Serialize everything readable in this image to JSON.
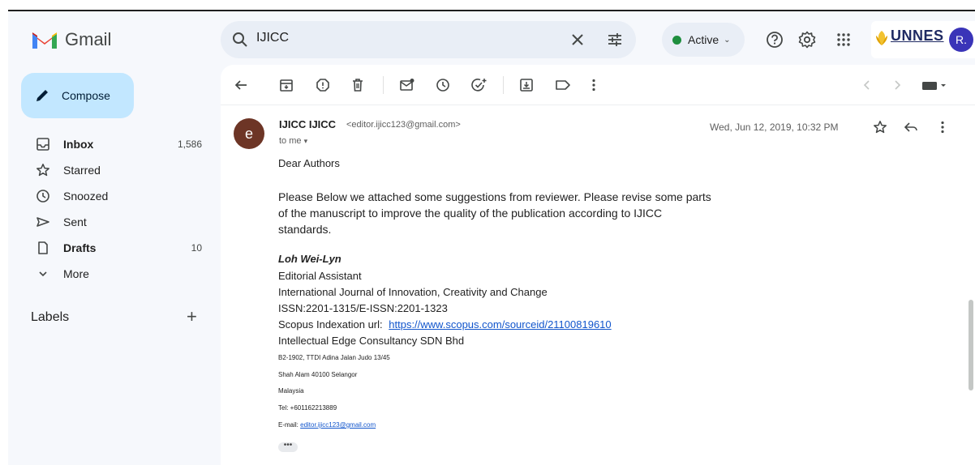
{
  "app": {
    "name": "Gmail"
  },
  "search": {
    "value": "IJICC"
  },
  "status": {
    "label": "Active"
  },
  "org_logo": {
    "text": "UNNES"
  },
  "account": {
    "initial": "R."
  },
  "compose": {
    "label": "Compose"
  },
  "nav": {
    "items": [
      {
        "label": "Inbox",
        "count": "1,586",
        "icon": "inbox-icon",
        "bold": true
      },
      {
        "label": "Starred",
        "count": "",
        "icon": "star-icon",
        "bold": false
      },
      {
        "label": "Snoozed",
        "count": "",
        "icon": "clock-icon",
        "bold": false
      },
      {
        "label": "Sent",
        "count": "",
        "icon": "send-icon",
        "bold": false
      },
      {
        "label": "Drafts",
        "count": "10",
        "icon": "draft-icon",
        "bold": true
      },
      {
        "label": "More",
        "count": "",
        "icon": "chevron-down-icon",
        "bold": false
      }
    ]
  },
  "labels": {
    "title": "Labels"
  },
  "email": {
    "sender_initial": "e",
    "sender_name": "IJICC IJICC",
    "sender_email": "<editor.ijicc123@gmail.com>",
    "to": "to me",
    "date": "Wed, Jun 12, 2019, 10:32 PM",
    "greeting": "Dear Authors",
    "paragraph": "Please Below we attached some suggestions from reviewer. Please revise some parts of the manuscript to improve the quality of the publication according to IJICC standards.",
    "signature": {
      "name": "Loh Wei-Lyn",
      "title": "Editorial Assistant",
      "journal": "International Journal of Innovation, Creativity and Change",
      "issn": "ISSN:2201-1315/E-ISSN:2201-1323",
      "scopus_label": "Scopus Indexation url:",
      "scopus_url": "https://www.scopus.com/sourceid/21100819610",
      "company": "Intellectual Edge Consultancy SDN Bhd",
      "address1": "B2-1902, TTDI Adina Jalan Judo 13/45",
      "address2": "Shah Alam 40100 Selangor",
      "country": "Malaysia",
      "tel": "Tel: +601162213889",
      "email_label": "E-mail:",
      "email_value": "editor.ijicc123@gmail.com"
    },
    "trimmed": "•••"
  },
  "colors": {
    "compose_bg": "#c2e7ff",
    "accent_link": "#1155cc",
    "active_dot": "#1e8e3e",
    "avatar_bg": "#3a34b8",
    "sender_avatar_bg": "#6d3526"
  }
}
